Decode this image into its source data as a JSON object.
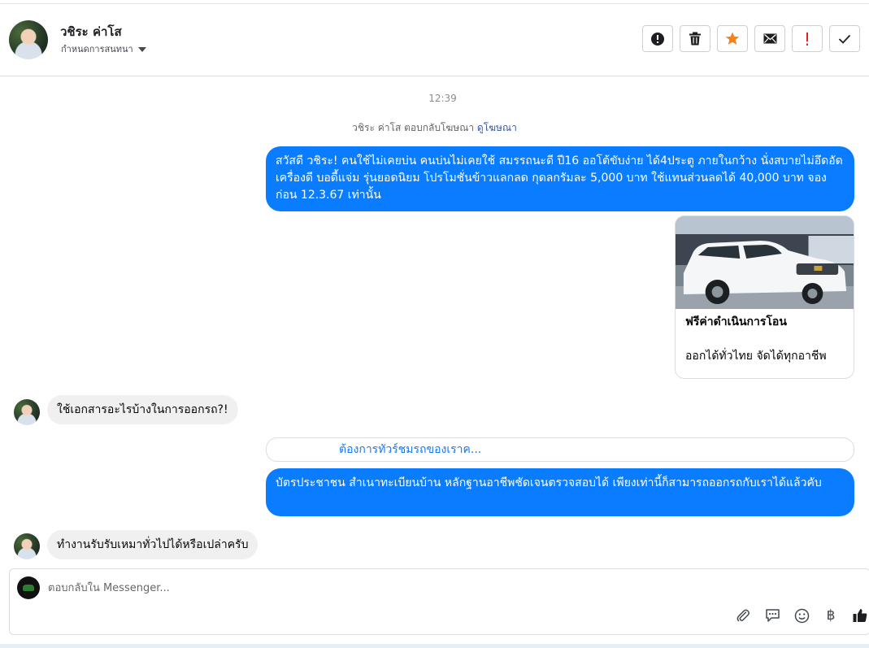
{
  "header": {
    "contact_name": "วชิระ ค่าโส",
    "subtitle": "กำหนดการสนทนา"
  },
  "toolbar": {
    "buttons": [
      {
        "name": "report-spam",
        "icon": "alert-circle-icon"
      },
      {
        "name": "delete",
        "icon": "trash-icon"
      },
      {
        "name": "star",
        "icon": "star-icon",
        "color": "#f5821f"
      },
      {
        "name": "mark-unread",
        "icon": "envelope-icon"
      },
      {
        "name": "mark-important",
        "icon": "exclamation-icon",
        "color": "#e02424"
      },
      {
        "name": "mark-done",
        "icon": "check-icon"
      }
    ]
  },
  "conversation": {
    "timestamp": "12:39",
    "ad_reply_prefix": "วชิระ ค่าโส ตอบกลับโฆษณา",
    "ad_reply_link": "ดูโฆษณา",
    "messages": [
      {
        "from": "page",
        "text": "สวัสดี วชิระ! คนใช้ไม่เคยบ่น คนบ่นไม่เคยใช้ สมรรถนะดี ปี16 ออโต้ขับง่าย ได้4ประตู ภายในกว้าง นั่งสบายไม่อึดอัด เครื่องดี บอดี้แจ่ม รุ่นยอดนิยม โปรโมชั่นข้าวแลกลด กุดลกรัมละ 5,000 บาท ใช้แทนส่วนลดได้ 40,000 บาท จองก่อน 12.3.67 เท่านั้น"
      },
      {
        "from": "page",
        "type": "card",
        "title": "ฟรีค่าดำเนินการโอน",
        "subtitle": "ออกได้ทั่วไทย จัดได้ทุกอาชีพ"
      },
      {
        "from": "user",
        "text": "ใช้เอกสารอะไรบ้างในการออกรถ?!"
      },
      {
        "from": "page",
        "type": "quick_reply",
        "text": "ต้องการทัวร์ชมรถของเราค..."
      },
      {
        "from": "page",
        "text": "บัตรประชาชน สำเนาทะเบียนบ้าน หลักฐานอาชีพชัดเจนตรวจสอบได้ เพียงเท่านี้ก็สามารถออกรถกับเราได้แล้วคับ"
      },
      {
        "from": "user",
        "text": "ทำงานรับรับเหมาทั่วไปได้หรือเปล่าครับ"
      }
    ]
  },
  "composer": {
    "placeholder": "ตอบกลับใน Messenger...",
    "value": "",
    "tools": [
      {
        "name": "attach",
        "icon": "paperclip-icon"
      },
      {
        "name": "saved-replies",
        "icon": "chat-bubble-icon"
      },
      {
        "name": "emoji",
        "icon": "smiley-icon"
      },
      {
        "name": "payment",
        "icon": "baht-icon",
        "glyph": "฿"
      },
      {
        "name": "like",
        "icon": "thumbs-up-icon"
      }
    ]
  },
  "colors": {
    "outgoing_bubble": "#0a7cff",
    "incoming_bubble": "#f0f0f0",
    "link": "#1877f2"
  }
}
